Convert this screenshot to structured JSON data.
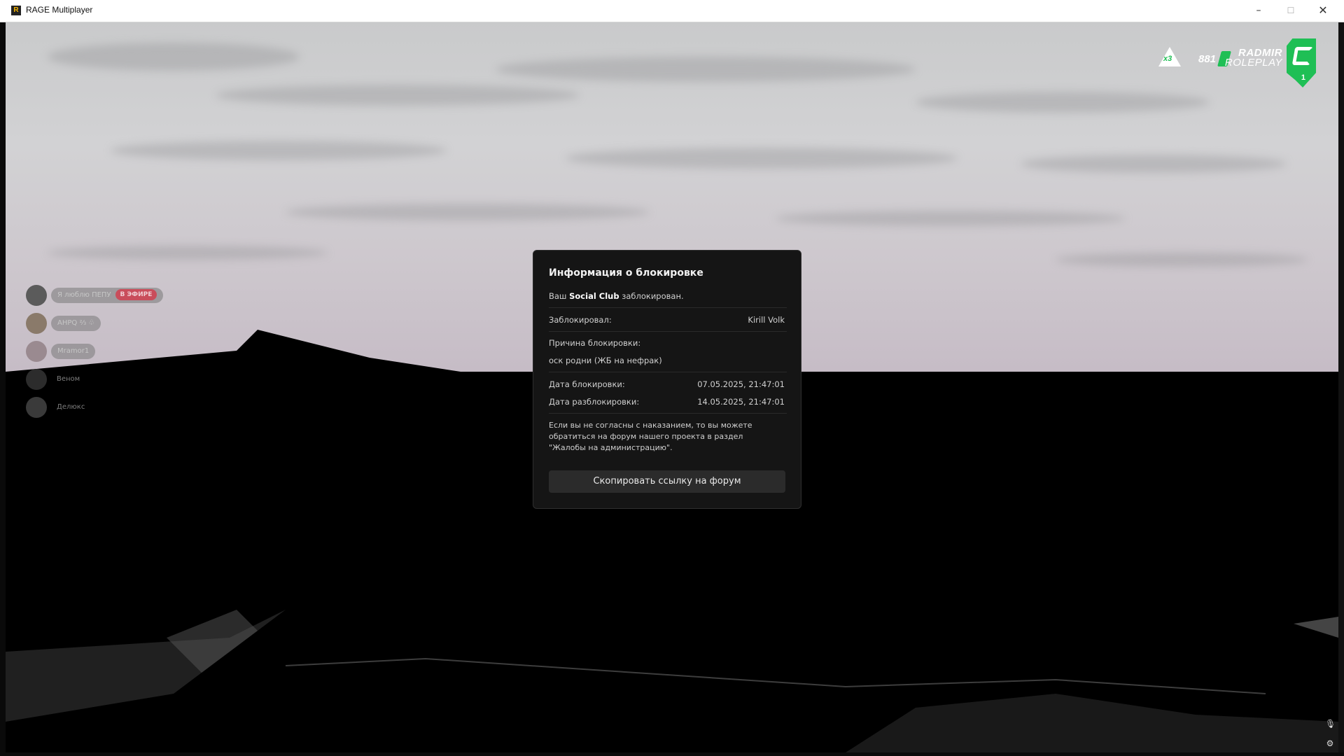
{
  "window": {
    "logo_letter": "R",
    "title": "RAGE Multiplayer",
    "minimize": "–",
    "maximize": "☐",
    "close": "✕"
  },
  "hud": {
    "multiplier": "x3",
    "online": "881",
    "brand_top": "RADMIR",
    "brand_bottom": "ROLEPLAY",
    "server": "1",
    "accent": "#1fbf55"
  },
  "voice": {
    "users": [
      {
        "name": "Я люблю ПЕПУ",
        "badge": "В ЭФИРЕ"
      },
      {
        "name": "АНРQ ⅔ ♧"
      },
      {
        "name": "Mramor1"
      },
      {
        "name": "Веном"
      },
      {
        "name": "Делюкс"
      }
    ]
  },
  "dialog": {
    "title": "Информация о блокировке",
    "intro_pre": "Ваш ",
    "intro_bold": "Social Club",
    "intro_post": " заблокирован.",
    "blocked_by_label": "Заблокировал:",
    "blocked_by_value": "Kirill Volk",
    "reason_label": "Причина блокировки:",
    "reason_value": "оск родни (ЖБ на нефрак)",
    "block_date_label": "Дата блокировки:",
    "block_date_value": "07.05.2025, 21:47:01",
    "unblock_date_label": "Дата разблокировки:",
    "unblock_date_value": "14.05.2025, 21:47:01",
    "note_lines": [
      "Если вы не согласны с наказанием, то вы можете",
      "обратиться на форум нашего проекта в раздел",
      "\"Жалобы на администрацию\"."
    ],
    "button_label": "Скопировать ссылку на форум"
  },
  "corner_icons": {
    "mic": "🎙",
    "settings": "⚙"
  }
}
